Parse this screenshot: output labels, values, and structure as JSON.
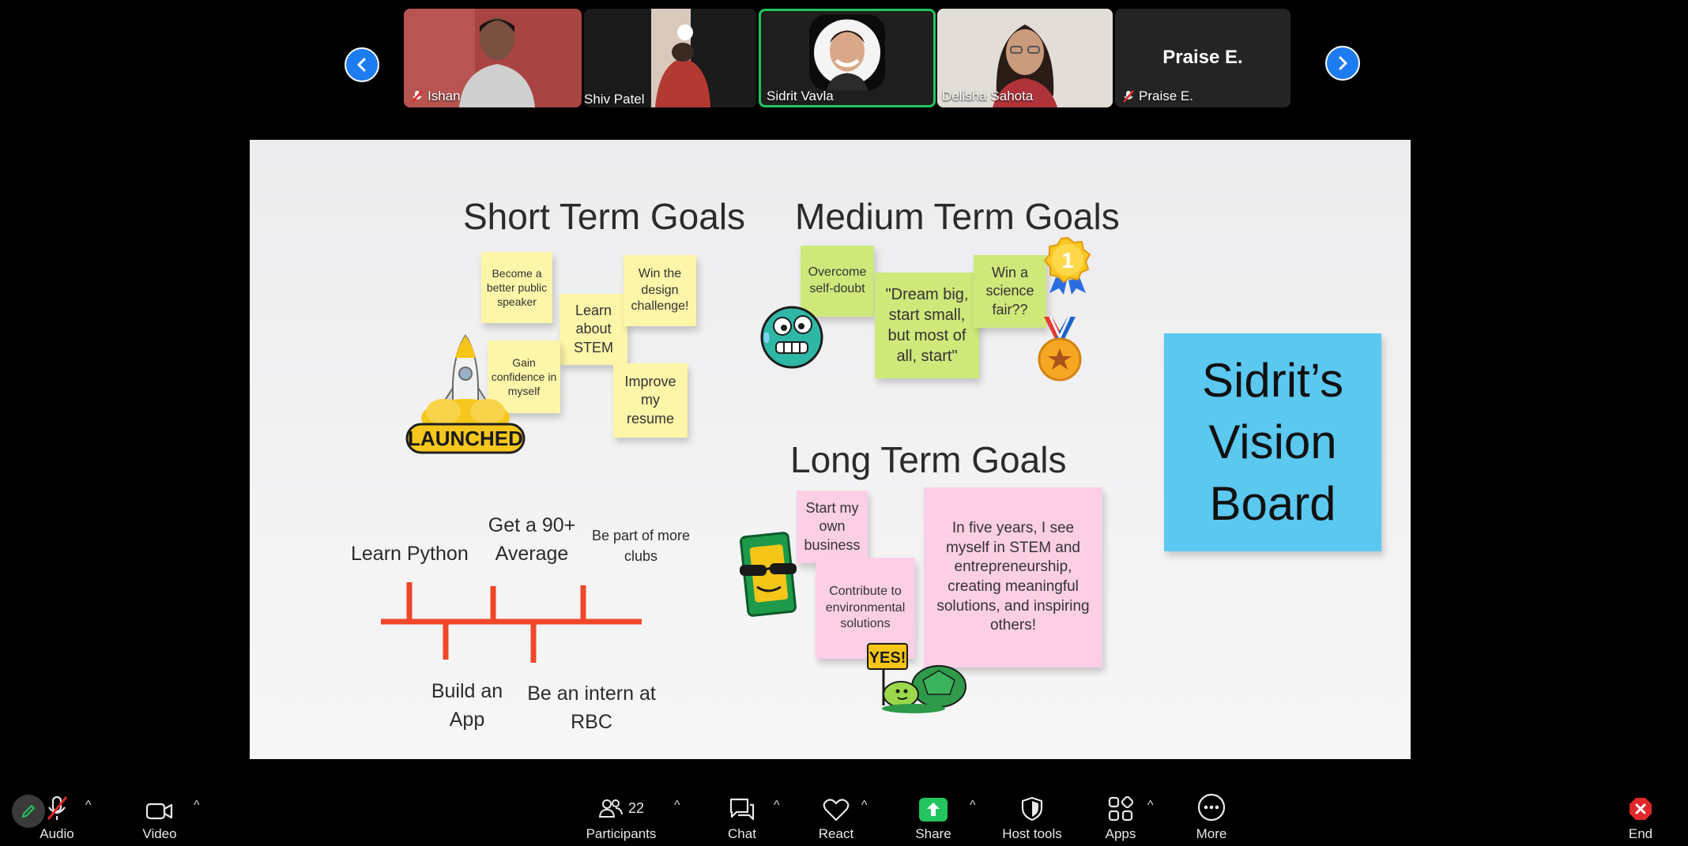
{
  "participants_strip": {
    "tiles": [
      {
        "name": "Ishan",
        "muted": true
      },
      {
        "name": "Shiv Patel",
        "muted": false
      },
      {
        "name": "Sidrit Vavla",
        "muted": false,
        "active": true
      },
      {
        "name": "Delisha Sahota",
        "muted": false
      },
      {
        "name": "Praise E.",
        "muted": true,
        "video_off_label": "Praise E."
      }
    ]
  },
  "board": {
    "short_term_title": "Short Term Goals",
    "medium_term_title": "Medium Term Goals",
    "long_term_title": "Long Term Goals",
    "launched_sticker": "LAUNCHED",
    "short_notes": {
      "speaker": "Become a better public speaker",
      "stem": "Learn about STEM",
      "design": "Win the design challenge!",
      "confidence": "Gain confidence in myself",
      "resume": "Improve my resume"
    },
    "medium_notes": {
      "selfdoubt": "Overcome self-doubt",
      "dream": "\"Dream big, start small, but most of all, start\"",
      "science": "Win a science fair??"
    },
    "medal_number": "1",
    "long_notes": {
      "business": "Start my own business",
      "environment": "Contribute to environmental solutions",
      "vision": "In five years, I see myself in STEM and entrepreneurship, creating meaningful solutions, and inspiring others!"
    },
    "yes_sign": "YES!",
    "title_card": {
      "line1": "Sidrit’s",
      "line2": "Vision",
      "line3": "Board"
    },
    "timeline": {
      "top": [
        "Learn Python",
        "Get a 90+ Average",
        "Be part of more clubs"
      ],
      "bottom": [
        "Build an App",
        "Be an intern at RBC"
      ]
    }
  },
  "toolbar": {
    "audio": "Audio",
    "video": "Video",
    "participants": "Participants",
    "participants_count": "22",
    "chat": "Chat",
    "react": "React",
    "share": "Share",
    "host_tools": "Host tools",
    "apps": "Apps",
    "more": "More",
    "end": "End"
  },
  "colors": {
    "accent_blue": "#1e7cf2",
    "active_speaker": "#22c55e",
    "share_green": "#22c55e",
    "end_red": "#e02828"
  }
}
